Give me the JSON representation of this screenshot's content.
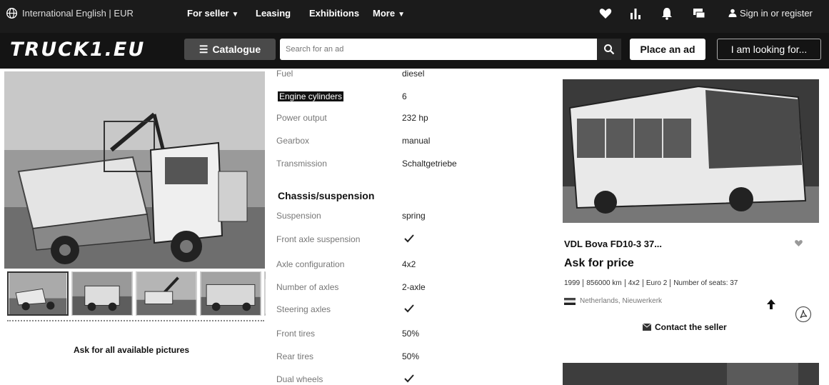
{
  "header": {
    "locale": "International English | EUR",
    "nav": [
      {
        "label": "For seller",
        "has_chevron": true
      },
      {
        "label": "Leasing",
        "has_chevron": false
      },
      {
        "label": "Exhibitions",
        "has_chevron": false
      },
      {
        "label": "More",
        "has_chevron": true
      }
    ],
    "icons": [
      "heart-icon",
      "chart-icon",
      "bell-icon",
      "chat-icon"
    ],
    "signin": "Sign in or register",
    "logo": "TRUCK1.EU",
    "catalogue": "Catalogue",
    "search_placeholder": "Search for an ad",
    "place_ad": "Place an ad",
    "looking_for": "I am looking for..."
  },
  "gallery": {
    "ask_pictures": "Ask for all available pictures",
    "thumbnail_count": 5
  },
  "specs": {
    "rows_engine": [
      {
        "label": "Fuel",
        "value": "diesel"
      },
      {
        "label": "Engine cylinders",
        "value": "6",
        "highlight": true
      },
      {
        "label": "Power output",
        "value": "232 hp"
      },
      {
        "label": "Gearbox",
        "value": "manual"
      },
      {
        "label": "Transmission",
        "value": "Schaltgetriebe"
      }
    ],
    "section_chassis": "Chassis/suspension",
    "rows_chassis": [
      {
        "label": "Suspension",
        "value": "spring"
      },
      {
        "label": "Front axle suspension",
        "check": true
      },
      {
        "label": "Axle configuration",
        "value": "4x2"
      },
      {
        "label": "Number of axles",
        "value": "2-axle"
      },
      {
        "label": "Steering axles",
        "check": true
      },
      {
        "label": "Front tires",
        "value": "50%"
      },
      {
        "label": "Rear tires",
        "value": "50%"
      },
      {
        "label": "Dual wheels",
        "check": true
      }
    ]
  },
  "listing": {
    "title": "VDL Bova FD10-3 37...",
    "price": "Ask for price",
    "facts": [
      "1999",
      "856000 km",
      "4x2",
      "Euro 2",
      "Number of seats: 37"
    ],
    "location": "Netherlands, Nieuwerkerk",
    "contact": "Contact the seller"
  },
  "colors": {
    "header_bg": "#1b1b1b",
    "search_bg": "#141414",
    "catalogue_bg": "#4a4a4a"
  }
}
